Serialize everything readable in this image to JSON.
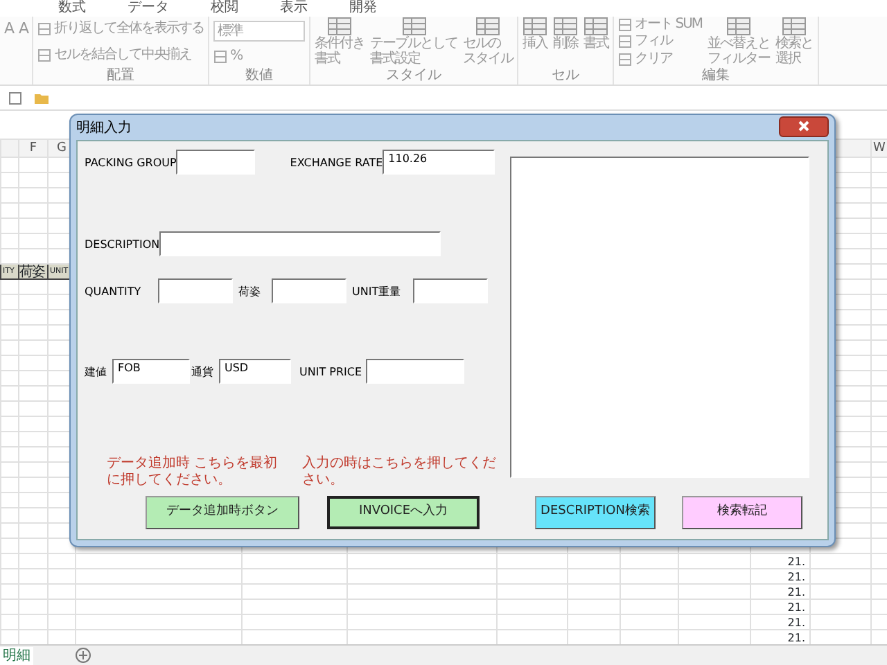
{
  "ribbon": {
    "tabs": [
      "数式",
      "データ",
      "校閲",
      "表示",
      "開発"
    ],
    "groups": [
      {
        "items": [
          {
            "kind": "glyph",
            "lines": [
              "A"
            ]
          },
          {
            "kind": "glyph",
            "lines": [
              "A"
            ]
          }
        ]
      },
      {
        "label": "配置",
        "items": [
          {
            "kind": "small",
            "lines": [
              "折り返して全体を表示する"
            ]
          },
          {
            "kind": "small",
            "lines": [
              "セルを結合して中央揃え"
            ]
          }
        ]
      },
      {
        "label": "数値",
        "items": [
          {
            "kind": "combo",
            "lines": [
              "標準"
            ]
          },
          {
            "kind": "small",
            "lines": [
              "%"
            ]
          }
        ]
      },
      {
        "label": "スタイル",
        "items": [
          {
            "kind": "big",
            "lines": [
              "条件付き",
              "書式"
            ]
          },
          {
            "kind": "big",
            "lines": [
              "テーブルとして",
              "書式設定"
            ]
          },
          {
            "kind": "big",
            "lines": [
              "セルの",
              "スタイル"
            ]
          }
        ]
      },
      {
        "label": "セル",
        "items": [
          {
            "kind": "big",
            "lines": [
              "挿入"
            ]
          },
          {
            "kind": "big",
            "lines": [
              "削除"
            ]
          },
          {
            "kind": "big",
            "lines": [
              "書式"
            ]
          }
        ]
      },
      {
        "label": "編集",
        "items": [
          {
            "kind": "small",
            "lines": [
              "オート SUM"
            ]
          },
          {
            "kind": "small",
            "lines": [
              "フィル"
            ]
          },
          {
            "kind": "small",
            "lines": [
              "クリア"
            ]
          },
          {
            "kind": "big",
            "lines": [
              "並べ替えと",
              "フィルター"
            ]
          },
          {
            "kind": "big",
            "lines": [
              "検索と",
              "選択"
            ]
          }
        ]
      }
    ]
  },
  "sheet": {
    "columns": [
      "F",
      "G",
      "W"
    ],
    "header_cells": [
      "ITY",
      "荷姿",
      "UNIT"
    ],
    "values": [
      "21.",
      "21.",
      "21.",
      "21.",
      "21.",
      "21."
    ],
    "sheet_tab": "明細"
  },
  "dialog": {
    "title": "明細入力",
    "fields": [
      {
        "label": "PACKING GROUP"
      },
      {
        "label": "EXCHANGE RATE",
        "value": "110.26"
      },
      {
        "label": "DESCRIPTION"
      },
      {
        "label": "QUANTITY"
      },
      {
        "label": "荷姿"
      },
      {
        "label": "UNIT重量"
      },
      {
        "label": "建値",
        "value": "FOB"
      },
      {
        "label": "通貨",
        "value": "USD"
      },
      {
        "label": "UNIT  PRICE"
      }
    ],
    "notes": [
      "データ追加時 こちらを最初に押してください。",
      "入力の時はこちらを押してください。"
    ],
    "buttons": [
      {
        "label": "データ追加時ボタン",
        "color": "#b4ecb4",
        "selected": false
      },
      {
        "label": "INVOICEへ入力",
        "color": "#b4ecb4",
        "selected": true
      },
      {
        "label": "DESCRIPTION検索",
        "color": "#66e3fa",
        "selected": false
      },
      {
        "label": "検索転記",
        "color": "#ffccff",
        "selected": false
      }
    ]
  }
}
